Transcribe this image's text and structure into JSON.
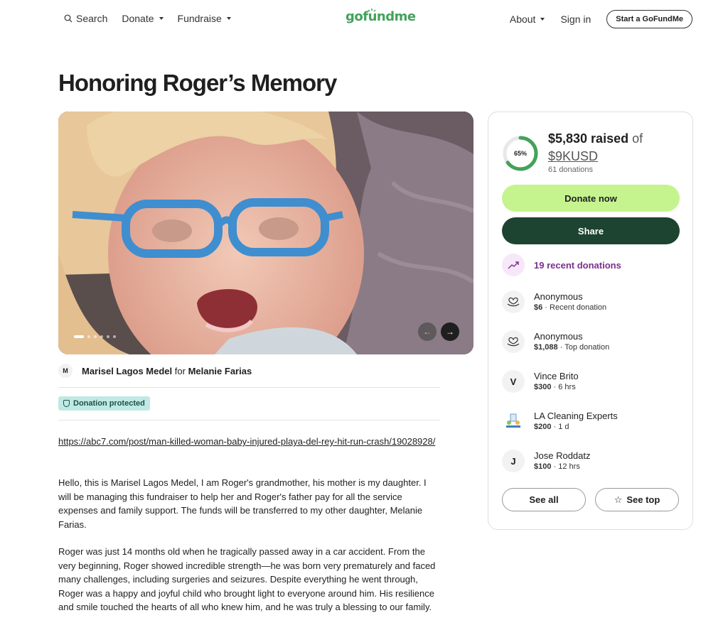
{
  "header": {
    "search_label": "Search",
    "search_icon": "search-icon",
    "donate_label": "Donate",
    "fundraise_label": "Fundraise",
    "logo_text": "gofundme",
    "about_label": "About",
    "signin_label": "Sign in",
    "start_label": "Start a GoFundMe"
  },
  "title": "Honoring Roger’s Memory",
  "hero": {
    "slide_count": 6,
    "active_slide": 1
  },
  "organizer": {
    "initial": "M",
    "name": "Marisel Lagos Medel",
    "for_word": "for",
    "beneficiary": "Melanie Farias"
  },
  "protection": {
    "label": "Donation protected"
  },
  "story": {
    "link": "https://abc7.com/post/man-killed-woman-baby-injured-playa-del-rey-hit-run-crash/19028928/",
    "paragraph1": "Hello, this is Marisel Lagos Medel, I am Roger's grandmother, his mother is my daughter. I will be managing this fundraiser to help her and Roger's father pay for all the service expenses and family support. The funds will be transferred to my other daughter, Melanie Farias.",
    "paragraph2": "Roger was just 14 months old when he tragically passed away in a car accident. From the very beginning, Roger showed incredible strength—he was born very prematurely and faced many challenges, including surgeries and seizures. Despite everything he went through, Roger was a happy and joyful child who brought light to everyone around him. His resilience and smile touched the hearts of all who knew him, and he was truly a blessing to our family."
  },
  "progress": {
    "percent_label": "65%",
    "percent_value": 0.65,
    "raised": "$5,830 raised",
    "of_word": "of",
    "goal": "$9KUSD",
    "donation_count": "61 donations",
    "ring_color": "#43a25a"
  },
  "actions": {
    "donate": "Donate now",
    "share": "Share",
    "see_all": "See all",
    "see_top": "See top"
  },
  "recent": {
    "label": "19 recent donations",
    "icon": "trending-up-icon"
  },
  "donations": [
    {
      "name": "Anonymous",
      "amount": "$6",
      "note": " · Recent donation",
      "avatar": "heart-hand-icon"
    },
    {
      "name": "Anonymous",
      "amount": "$1,088",
      "note": " · Top donation",
      "avatar": "heart-hand-icon"
    },
    {
      "name": "Vince Brito",
      "amount": "$300",
      "note": " · 6 hrs",
      "avatar_initial": "V"
    },
    {
      "name": "LA Cleaning Experts",
      "amount": "$200",
      "note": " · 1 d",
      "avatar": "company-logo"
    },
    {
      "name": "Jose Roddatz",
      "amount": "$100",
      "note": " · 12 hrs",
      "avatar_initial": "J"
    }
  ],
  "colors": {
    "brand": "#43a25a",
    "donate_bg": "#c5f48f",
    "share_bg": "#1c4430",
    "recent_accent": "#7b2e8e",
    "protected_bg": "#bfe9e4"
  }
}
